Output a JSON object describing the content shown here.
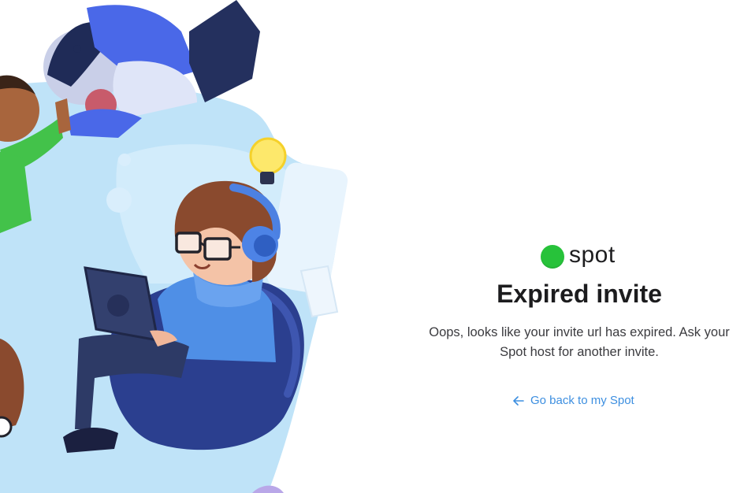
{
  "brand": {
    "name": "spot",
    "dot_color": "#27c23a"
  },
  "page": {
    "title": "Expired invite",
    "message": "Oops, looks like your invite url has expired. Ask your Spot host for another invite."
  },
  "actions": {
    "back_link_label": "Go back to my Spot",
    "back_link_icon": "arrow-left-icon",
    "link_color": "#3d8fe0"
  },
  "illustration": {
    "icons": [
      "person-with-laptop",
      "headphones",
      "lightbulb",
      "beanbag-chair",
      "floating-people"
    ]
  }
}
